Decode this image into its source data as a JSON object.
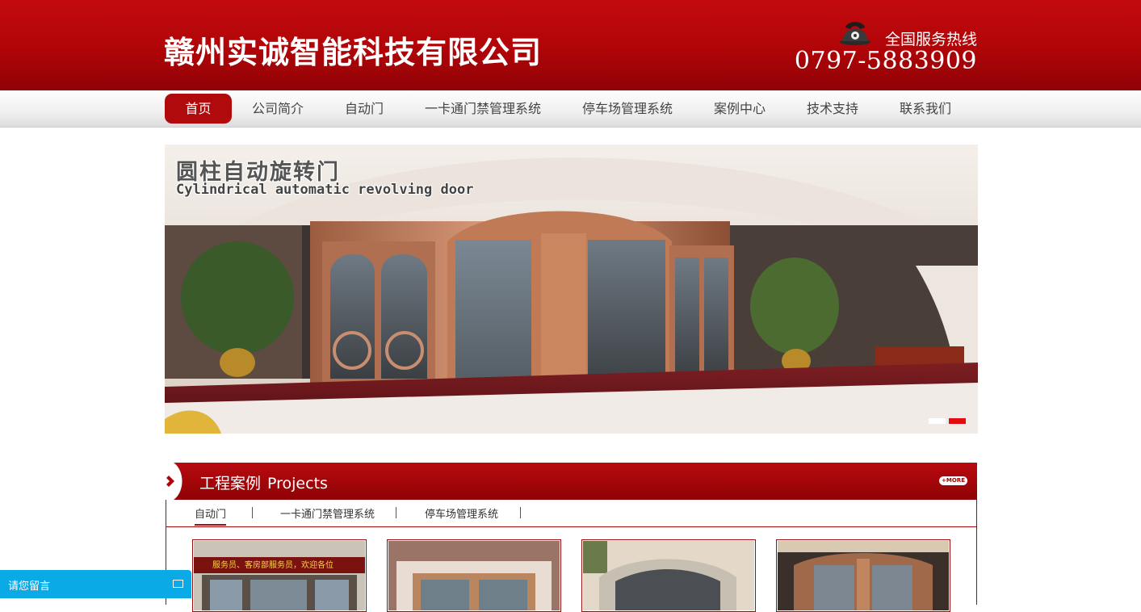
{
  "header": {
    "company_name": "赣州实诚智能科技有限公司",
    "hotline_label": "全国服务热线",
    "hotline_number": "0797-5883909"
  },
  "nav": {
    "items": [
      {
        "label": "首页",
        "active": true
      },
      {
        "label": "公司简介",
        "active": false
      },
      {
        "label": "自动门",
        "active": false
      },
      {
        "label": "一卡通门禁管理系统",
        "active": false
      },
      {
        "label": "停车场管理系统",
        "active": false
      },
      {
        "label": "案例中心",
        "active": false
      },
      {
        "label": "技术支持",
        "active": false
      },
      {
        "label": "联系我们",
        "active": false
      }
    ]
  },
  "banner": {
    "title_cn": "圆柱自动旋转门",
    "title_en": "Cylindrical automatic revolving door",
    "slides_total": 2,
    "active_slide": 2
  },
  "projects": {
    "title_cn": "工程案例",
    "title_en": "Projects",
    "more_label": "+MORE",
    "tabs": [
      {
        "label": "自动门",
        "active": true
      },
      {
        "label": "一卡通门禁管理系统",
        "active": false
      },
      {
        "label": "停车场管理系统",
        "active": false
      }
    ],
    "thumbnail_caption": "服务员、客房部服务员，欢迎各位"
  },
  "message": {
    "label": "请您留言"
  },
  "colors": {
    "brand_red": "#b00508",
    "accent_blue": "#0aaae6",
    "dot_active": "#e30a10",
    "dot_inactive": "#ffffff"
  },
  "icons": [
    "phone-icon",
    "chevron-right-icon",
    "message-box-icon"
  ]
}
